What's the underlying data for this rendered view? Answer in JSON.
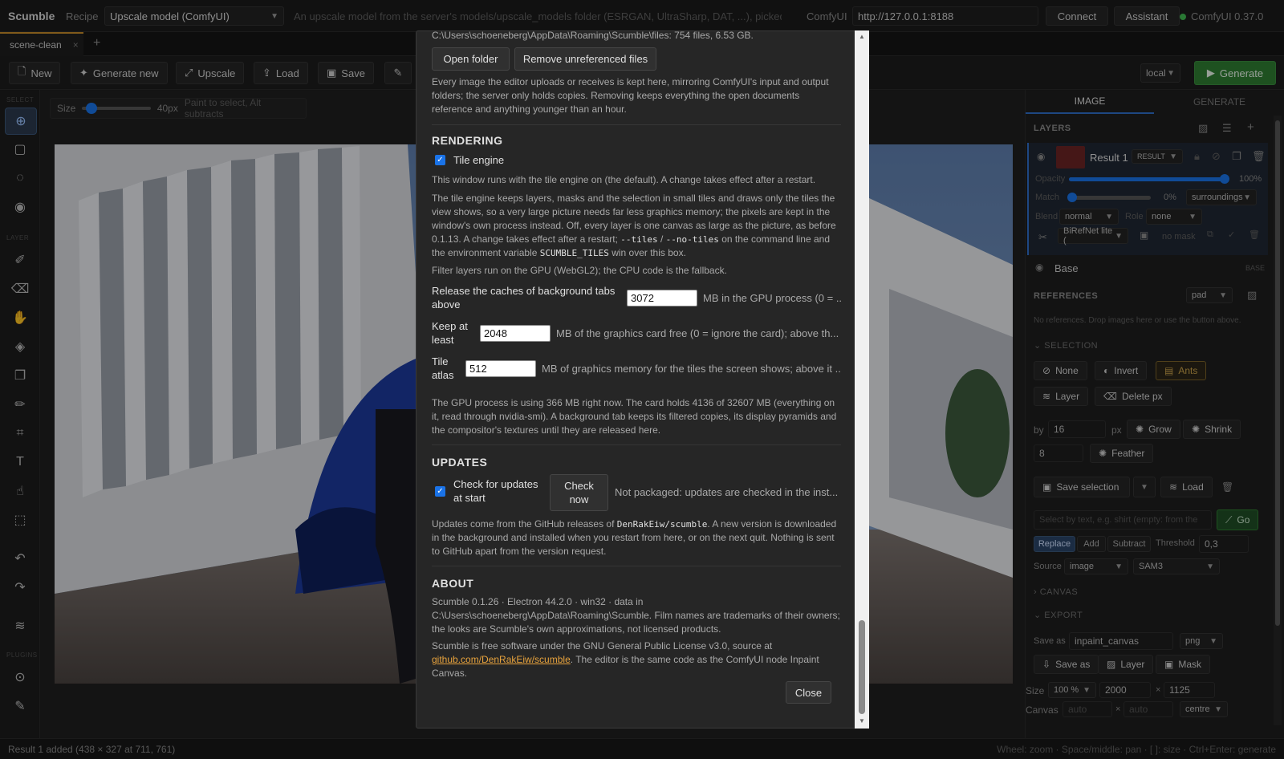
{
  "topbar": {
    "brand": "Scumble",
    "recipe_label": "Recipe",
    "recipe_value": "Upscale model (ComfyUI)",
    "recipe_desc": "An upscale model from the server's models/upscale_models folder (ESRGAN, UltraSharp, DAT, ...), picked ...",
    "comfy_label": "ComfyUI",
    "url": "http://127.0.0.1:8188",
    "connect": "Connect",
    "assistant": "Assistant",
    "status": "ComfyUI 0.37.0"
  },
  "tabs": [
    {
      "label": "scene-clean"
    }
  ],
  "toolbar": {
    "new": "New",
    "generate_new": "Generate new",
    "upscale": "Upscale",
    "load": "Load",
    "save": "Save",
    "target": "local",
    "generate": "Generate"
  },
  "leftbar": {
    "select": "SELECT",
    "layer": "LAYER",
    "plugins": "PLUGINS"
  },
  "brush": {
    "size_label": "Size",
    "size_value": "40px",
    "hint": "Paint to select, Alt subtracts",
    "size_fraction": 0.1
  },
  "status": {
    "left": "Result 1 added (438 × 327 at 711, 761)",
    "right": "Wheel: zoom · Space/middle: pan · [ ]: size · Ctrl+Enter: generate"
  },
  "right": {
    "tab_image": "IMAGE",
    "tab_generate": "GENERATE",
    "layers_title": "LAYERS",
    "layer1": {
      "name": "Result 1",
      "tag": "RESULT"
    },
    "opacity_label": "Opacity",
    "opacity_value": "100%",
    "opacity_fraction": 1.0,
    "match_label": "Match",
    "match_value": "0%",
    "match_select": "surroundings",
    "match_fraction": 0.0,
    "blend_label": "Blend",
    "blend_value": "normal",
    "role_label": "Role",
    "role_value": "none",
    "matting_value": "BiRefNet lite (",
    "no_mask": "no mask",
    "base": {
      "name": "Base",
      "tag": "BASE"
    },
    "references_title": "REFERENCES",
    "ref_mode": "pad",
    "references_empty": "No references. Drop images here or use the button above.",
    "selection_title": "SELECTION",
    "sel_none": "None",
    "sel_invert": "Invert",
    "sel_ants": "Ants",
    "sel_layer": "Layer",
    "sel_delete": "Delete px",
    "by_label": "by",
    "by_value": "16",
    "px": "px",
    "grow": "Grow",
    "shrink": "Shrink",
    "feather_value": "8",
    "feather": "Feather",
    "save_selection": "Save selection",
    "load": "Load",
    "text_placeholder": "Select by text, e.g. shirt (empty: from the",
    "go": "Go",
    "replace": "Replace",
    "add": "Add",
    "subtract": "Subtract",
    "threshold_label": "Threshold",
    "threshold_value": "0,3",
    "source_label": "Source",
    "source_value": "image",
    "model_value": "SAM3",
    "canvas_title": "CANVAS",
    "export_title": "EXPORT",
    "save_as_label": "Save as",
    "save_as_value": "inpaint_canvas",
    "format": "png",
    "save_as_btn": "Save as",
    "layer_btn": "Layer",
    "mask_btn": "Mask",
    "size_label": "Size",
    "size_pct": "100 %",
    "size_w": "2000",
    "size_x": "×",
    "size_h": "1125",
    "canvas_label": "Canvas",
    "canvas_w": "auto",
    "canvas_h": "auto",
    "canvas_align": "centre"
  },
  "modal": {
    "files_path": "C:\\Users\\schoeneberg\\AppData\\Roaming\\Scumble\\files: 754 files, 6.53 GB.",
    "open_folder": "Open folder",
    "remove_unref": "Remove unreferenced files",
    "files_desc": "Every image the editor uploads or receives is kept here, mirroring ComfyUI's input and output folders; the server only holds copies. Removing keeps everything the open documents reference and anything younger than an hour.",
    "rendering_title": "RENDERING",
    "tile_engine_label": "Tile engine",
    "tile_engine_note": "This window runs with the tile engine on (the default). A change takes effect after a restart.",
    "tile_desc_1": "The tile engine keeps layers, masks and the selection in small tiles and draws only the tiles the view shows, so a very large picture needs far less graphics memory; the pixels are kept in the window's own process instead. Off, every layer is one canvas as large as the picture, as before 0.1.13. A change takes effect after a restart;",
    "code_tiles": "--tiles",
    "slash": "/",
    "code_notiles": "--no-tiles",
    "tile_desc_2": "on the command line and the environment variable",
    "code_env": "SCUMBLE_TILES",
    "tile_desc_3": "win over this box.",
    "filter_note": "Filter layers run on the GPU (WebGL2); the CPU code is the fallback.",
    "release_label": "Release the caches of background tabs above",
    "release_value": "3072",
    "release_unit": "MB in the GPU process (0 = ...",
    "keep_label": "Keep at least",
    "keep_value": "2048",
    "keep_unit": "MB of the graphics card free (0 = ignore the card); above th...",
    "atlas_label": "Tile atlas",
    "atlas_value": "512",
    "atlas_unit": "MB of graphics memory for the tiles the screen shows; above it ...",
    "gpu_desc": "The GPU process is using 366 MB right now. The card holds 4136 of 32607 MB (everything on it, read through nvidia-smi). A background tab keeps its filtered copies, its display pyramids and the compositor's textures until they are released here.",
    "updates_title": "UPDATES",
    "check_start_label": "Check for updates at start",
    "check_now": "Check now",
    "not_packaged": "Not packaged: updates are checked in the inst...",
    "updates_desc_1": "Updates come from the GitHub releases of",
    "code_repo": "DenRakEiw/scumble",
    "updates_desc_2": ". A new version is downloaded in the background and installed when you restart from here, or on the next quit. Nothing is sent to GitHub apart from the version request.",
    "about_title": "ABOUT",
    "about_desc": "Scumble 0.1.26 · Electron 44.2.0 · win32 · data in C:\\Users\\schoeneberg\\AppData\\Roaming\\Scumble. Film names are trademarks of their owners; the looks are Scumble's own approximations, not licensed products.",
    "license_1": "Scumble is free software under the GNU General Public License v3.0, source at",
    "license_link": "github.com/DenRakEiw/scumble",
    "license_2": ". The editor is the same code as the ComfyUI node Inpaint Canvas.",
    "close": "Close"
  },
  "colors": {
    "accent": "#1a73e8",
    "generate": "#2e7d32",
    "link": "#e8a33d",
    "ants": "#caa24a"
  },
  "icons": [
    "plus-icon",
    "sparkle-icon",
    "expand-icon",
    "upload-icon",
    "floppy-icon",
    "pencil-icon",
    "play-icon"
  ]
}
